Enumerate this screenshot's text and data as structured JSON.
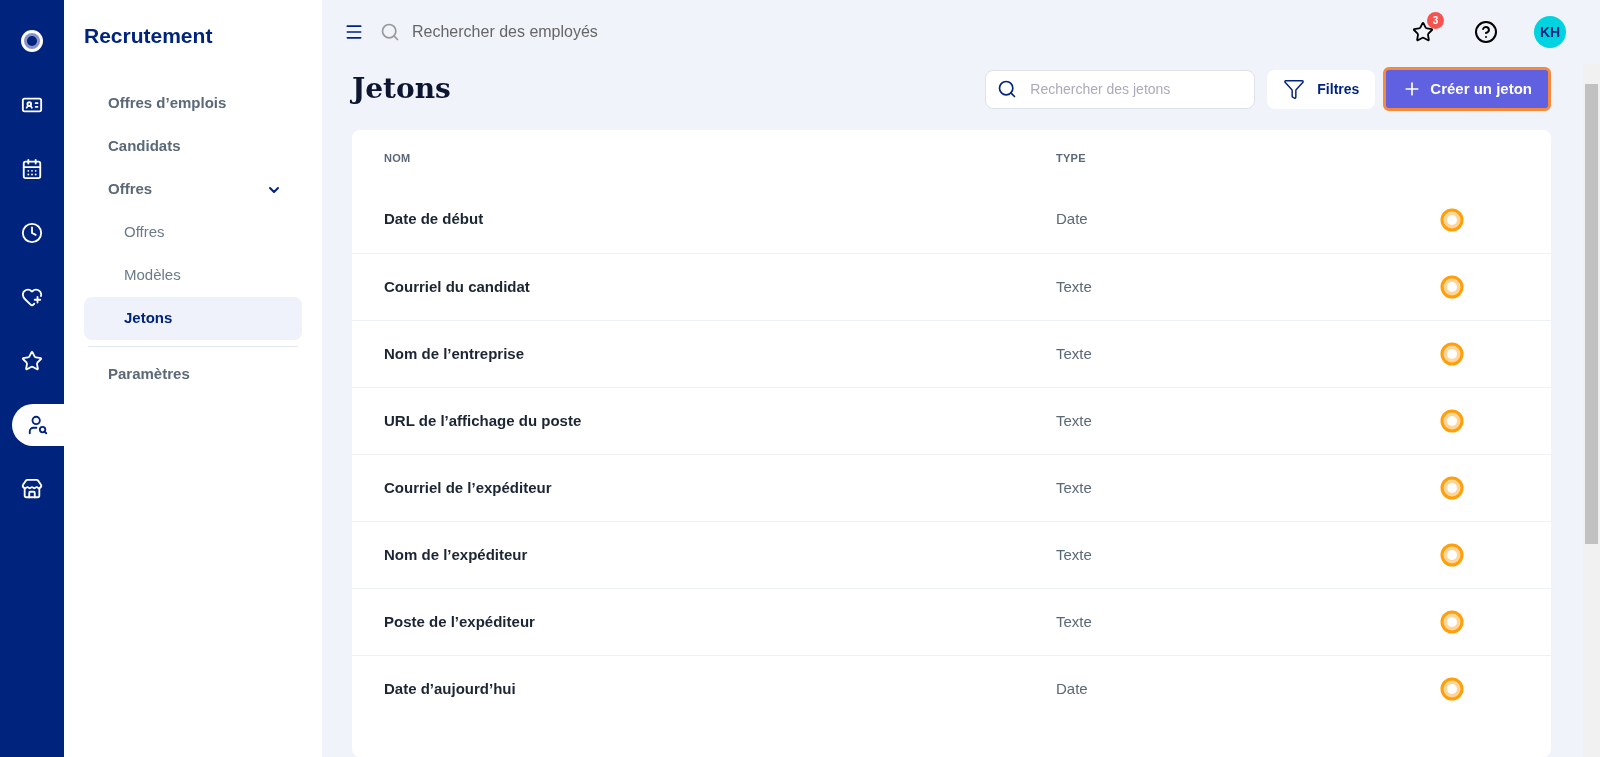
{
  "rail": [
    {
      "kind": "logo",
      "selected": false
    },
    {
      "kind": "id-card",
      "selected": false
    },
    {
      "kind": "calendar",
      "selected": false
    },
    {
      "kind": "clock",
      "selected": false
    },
    {
      "kind": "heart",
      "selected": false
    },
    {
      "kind": "star",
      "selected": false
    },
    {
      "kind": "person-search",
      "selected": true
    },
    {
      "kind": "store",
      "selected": false
    }
  ],
  "sidebar": {
    "title": "Recrutement",
    "items": [
      {
        "label": "Offres d’emplois",
        "selected": false
      },
      {
        "label": "Candidats",
        "selected": false
      },
      {
        "label": "Offres",
        "selected": false,
        "expanded": true,
        "children": [
          {
            "label": "Offres",
            "selected": false
          },
          {
            "label": "Modèles",
            "selected": false
          },
          {
            "label": "Jetons",
            "selected": true
          }
        ]
      },
      {
        "label": "Paramètres",
        "selected": false
      }
    ]
  },
  "topbar": {
    "search": {
      "placeholder": "Rechercher des employés"
    },
    "notifications": "3",
    "avatar": "KH"
  },
  "page": {
    "title": "Jetons",
    "search": {
      "placeholder": "Rechercher des jetons"
    },
    "filter_button": "Filtres",
    "create_button": "Créer un jeton"
  },
  "table": {
    "columns": [
      "NOM",
      "TYPE"
    ],
    "rows": [
      {
        "name": "Date de début",
        "type": "Date"
      },
      {
        "name": "Courriel du candidat",
        "type": "Texte"
      },
      {
        "name": "Nom de l’entreprise",
        "type": "Texte"
      },
      {
        "name": "URL de l’affichage du poste",
        "type": "Texte"
      },
      {
        "name": "Courriel de l’expéditeur",
        "type": "Texte"
      },
      {
        "name": "Nom de l’expéditeur",
        "type": "Texte"
      },
      {
        "name": "Poste de l’expéditeur",
        "type": "Texte"
      },
      {
        "name": "Date d’aujourd’hui",
        "type": "Date"
      }
    ]
  }
}
